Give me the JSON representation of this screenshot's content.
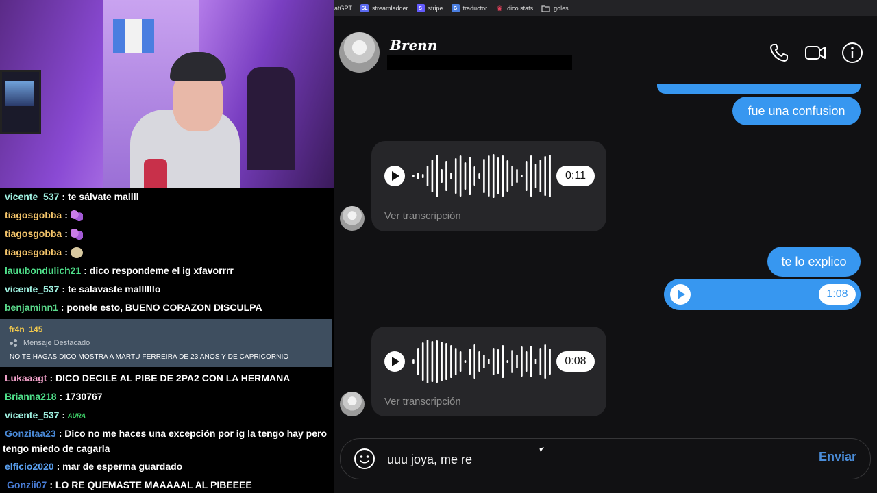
{
  "bookmarks": [
    {
      "label": "atGPT",
      "icon": "",
      "icon_color": "#232326"
    },
    {
      "label": "streamladder",
      "icon": "SL",
      "icon_color": "#5b6af0"
    },
    {
      "label": "stripe",
      "icon": "S",
      "icon_color": "#635bff"
    },
    {
      "label": "traductor",
      "icon": "G",
      "icon_color": "#4a7ee0"
    },
    {
      "label": "dico stats",
      "icon": "◉",
      "icon_color": "#e0405a"
    },
    {
      "label": "goles",
      "icon": "▭",
      "icon_color": "#232326"
    }
  ],
  "chat": {
    "lines": [
      {
        "user": "vicente_537",
        "color": "#9ff0e0",
        "text": "te sálvate mallll"
      },
      {
        "user": "tiagosgobba",
        "color": "#f3c46a",
        "text": "",
        "emote": "butterfly"
      },
      {
        "user": "tiagosgobba",
        "color": "#f3c46a",
        "text": "",
        "emote": "butterfly"
      },
      {
        "user": "tiagosgobba",
        "color": "#f3c46a",
        "text": "",
        "emote": "face"
      },
      {
        "user": "lauubondulich21",
        "color": "#4fe08a",
        "text": "dico respondeme el ig xfavorrrr"
      },
      {
        "user": "vicente_537",
        "color": "#9ff0e0",
        "text": "te salavaste mallllllo"
      },
      {
        "user": "benjaminn1",
        "color": "#5ad88a",
        "text": "ponele esto, BUENO CORAZON DISCULPA"
      }
    ],
    "highlight": {
      "user": "fr4n_145",
      "label": "Mensaje Destacado",
      "message": "NO TE HAGAS DICO MOSTRA A MARTU FERREIRA DE 23 AÑOS Y DE CAPRICORNIO"
    },
    "lines2": [
      {
        "user": "Lukaaagt",
        "color": "#f0a0c8",
        "text": "DICO DECILE AL PIBE DE 2PA2 CON LA HERMANA"
      },
      {
        "user": "Brianna218",
        "color": "#4fe08a",
        "text": "1730767"
      },
      {
        "user": "vicente_537",
        "color": "#9ff0e0",
        "text": "",
        "emote": "aura",
        "emote_text": "AURA"
      },
      {
        "user": "Gonzitaa23",
        "color": "#4a8ad8",
        "text": "Dico no me haces una excepción por ig la tengo hay pero"
      },
      {
        "user": "",
        "color": "#fff",
        "text": "tengo miedo de cagarla"
      },
      {
        "user": "elficio2020",
        "color": "#5aa0f0",
        "text": "mar de esperma guardado"
      },
      {
        "user": "Gonzii07",
        "color": "#4a7ed8",
        "text": "LO RE QUEMASTE MAAAAAL AL PIBEEEE"
      }
    ]
  },
  "dm": {
    "contact_name": "Brenn",
    "messages": {
      "out1": "fue una confusion",
      "audio1_duration": "0:11",
      "audio1_transcript": "Ver transcripción",
      "out2": "te lo explico",
      "audio_out_duration": "1:08",
      "audio2_duration": "0:08",
      "audio2_transcript": "Ver transcripción"
    },
    "composer": {
      "value": "uuu joya, me re",
      "send_label": "Enviar"
    },
    "colors": {
      "accent": "#3797f0",
      "background": "#111113"
    }
  }
}
